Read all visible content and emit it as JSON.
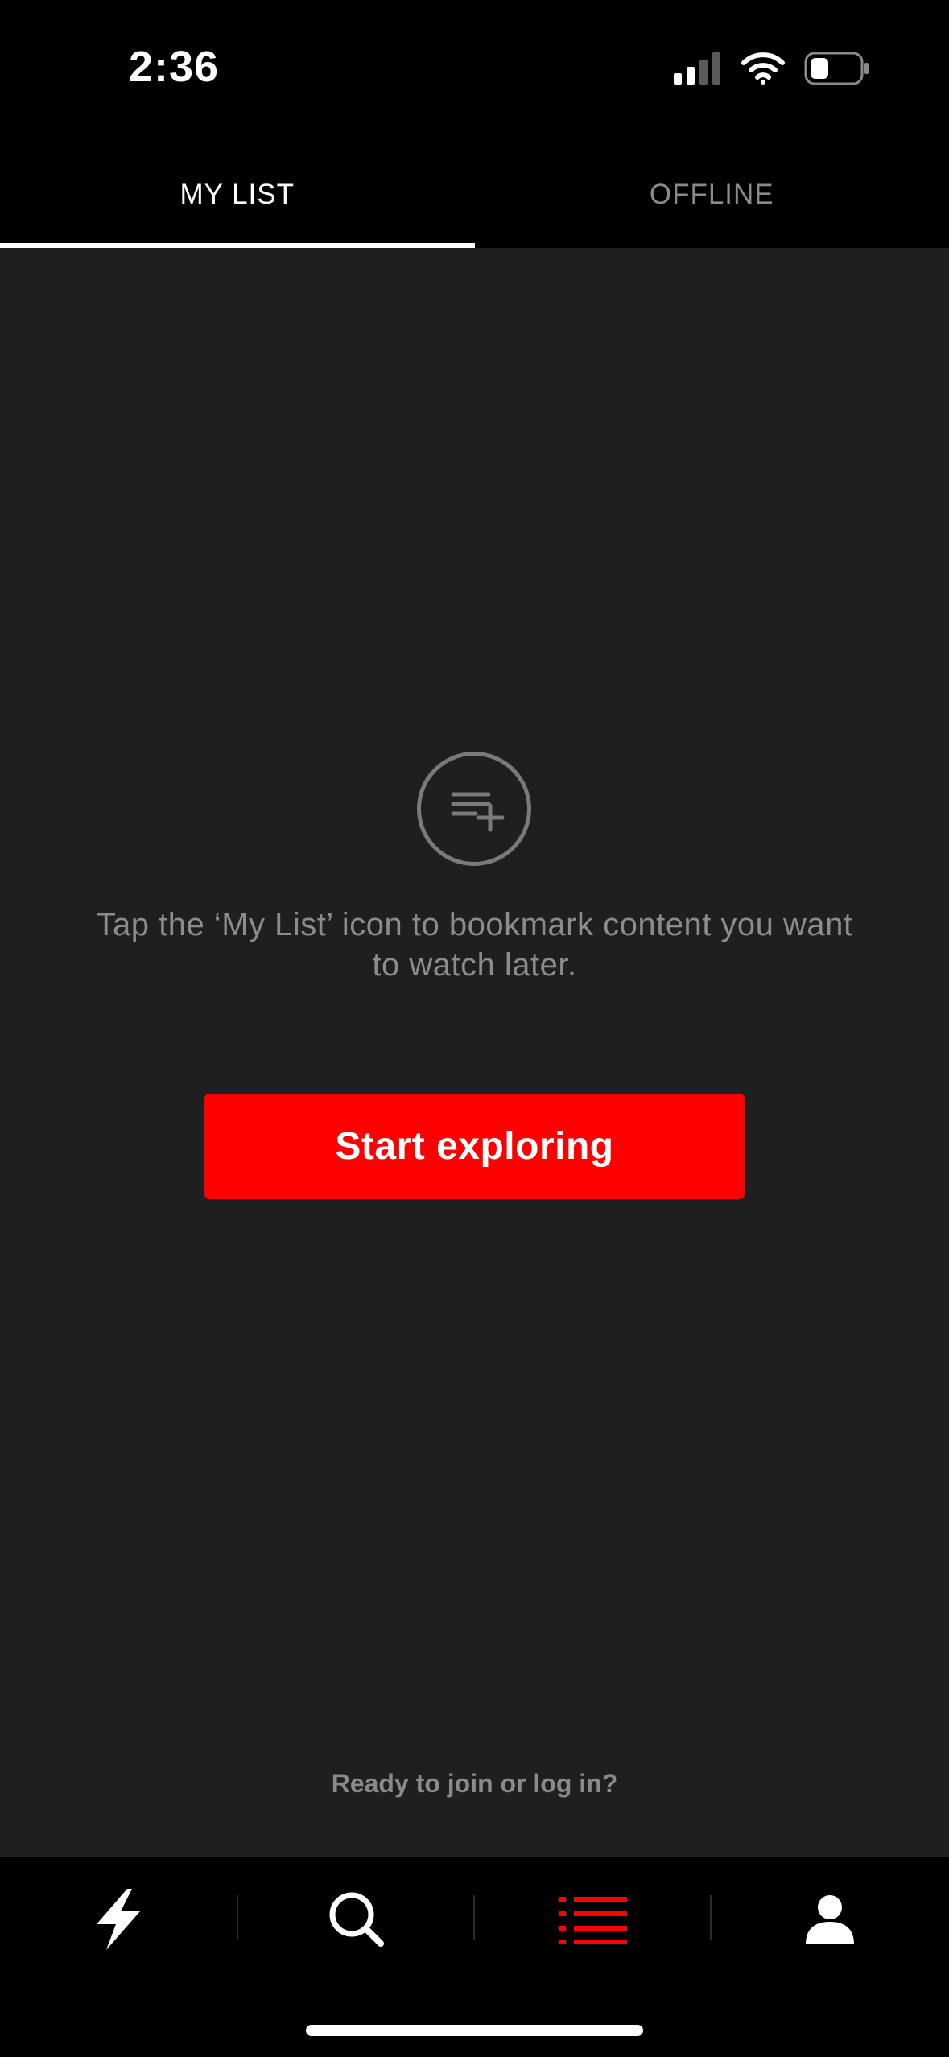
{
  "status_bar": {
    "time": "2:36",
    "icons": [
      "cellular-signal-icon",
      "wifi-icon",
      "battery-icon"
    ]
  },
  "tabs": [
    {
      "label": "MY LIST",
      "active": true
    },
    {
      "label": "OFFLINE",
      "active": false
    }
  ],
  "empty_state": {
    "icon": "playlist-add-icon",
    "message": "Tap the ‘My List’ icon to bookmark content you want to watch later.",
    "button_label": "Start exploring"
  },
  "join_prompt": "Ready to join or log in?",
  "bottom_nav": [
    {
      "icon": "lightning-icon",
      "active": false
    },
    {
      "icon": "search-icon",
      "active": false
    },
    {
      "icon": "list-icon",
      "active": true
    },
    {
      "icon": "profile-icon",
      "active": false
    }
  ],
  "colors": {
    "accent": "#ff0000",
    "background": "#1f1f1f",
    "bar_background": "#000000",
    "muted_text": "#8a8a8a"
  }
}
